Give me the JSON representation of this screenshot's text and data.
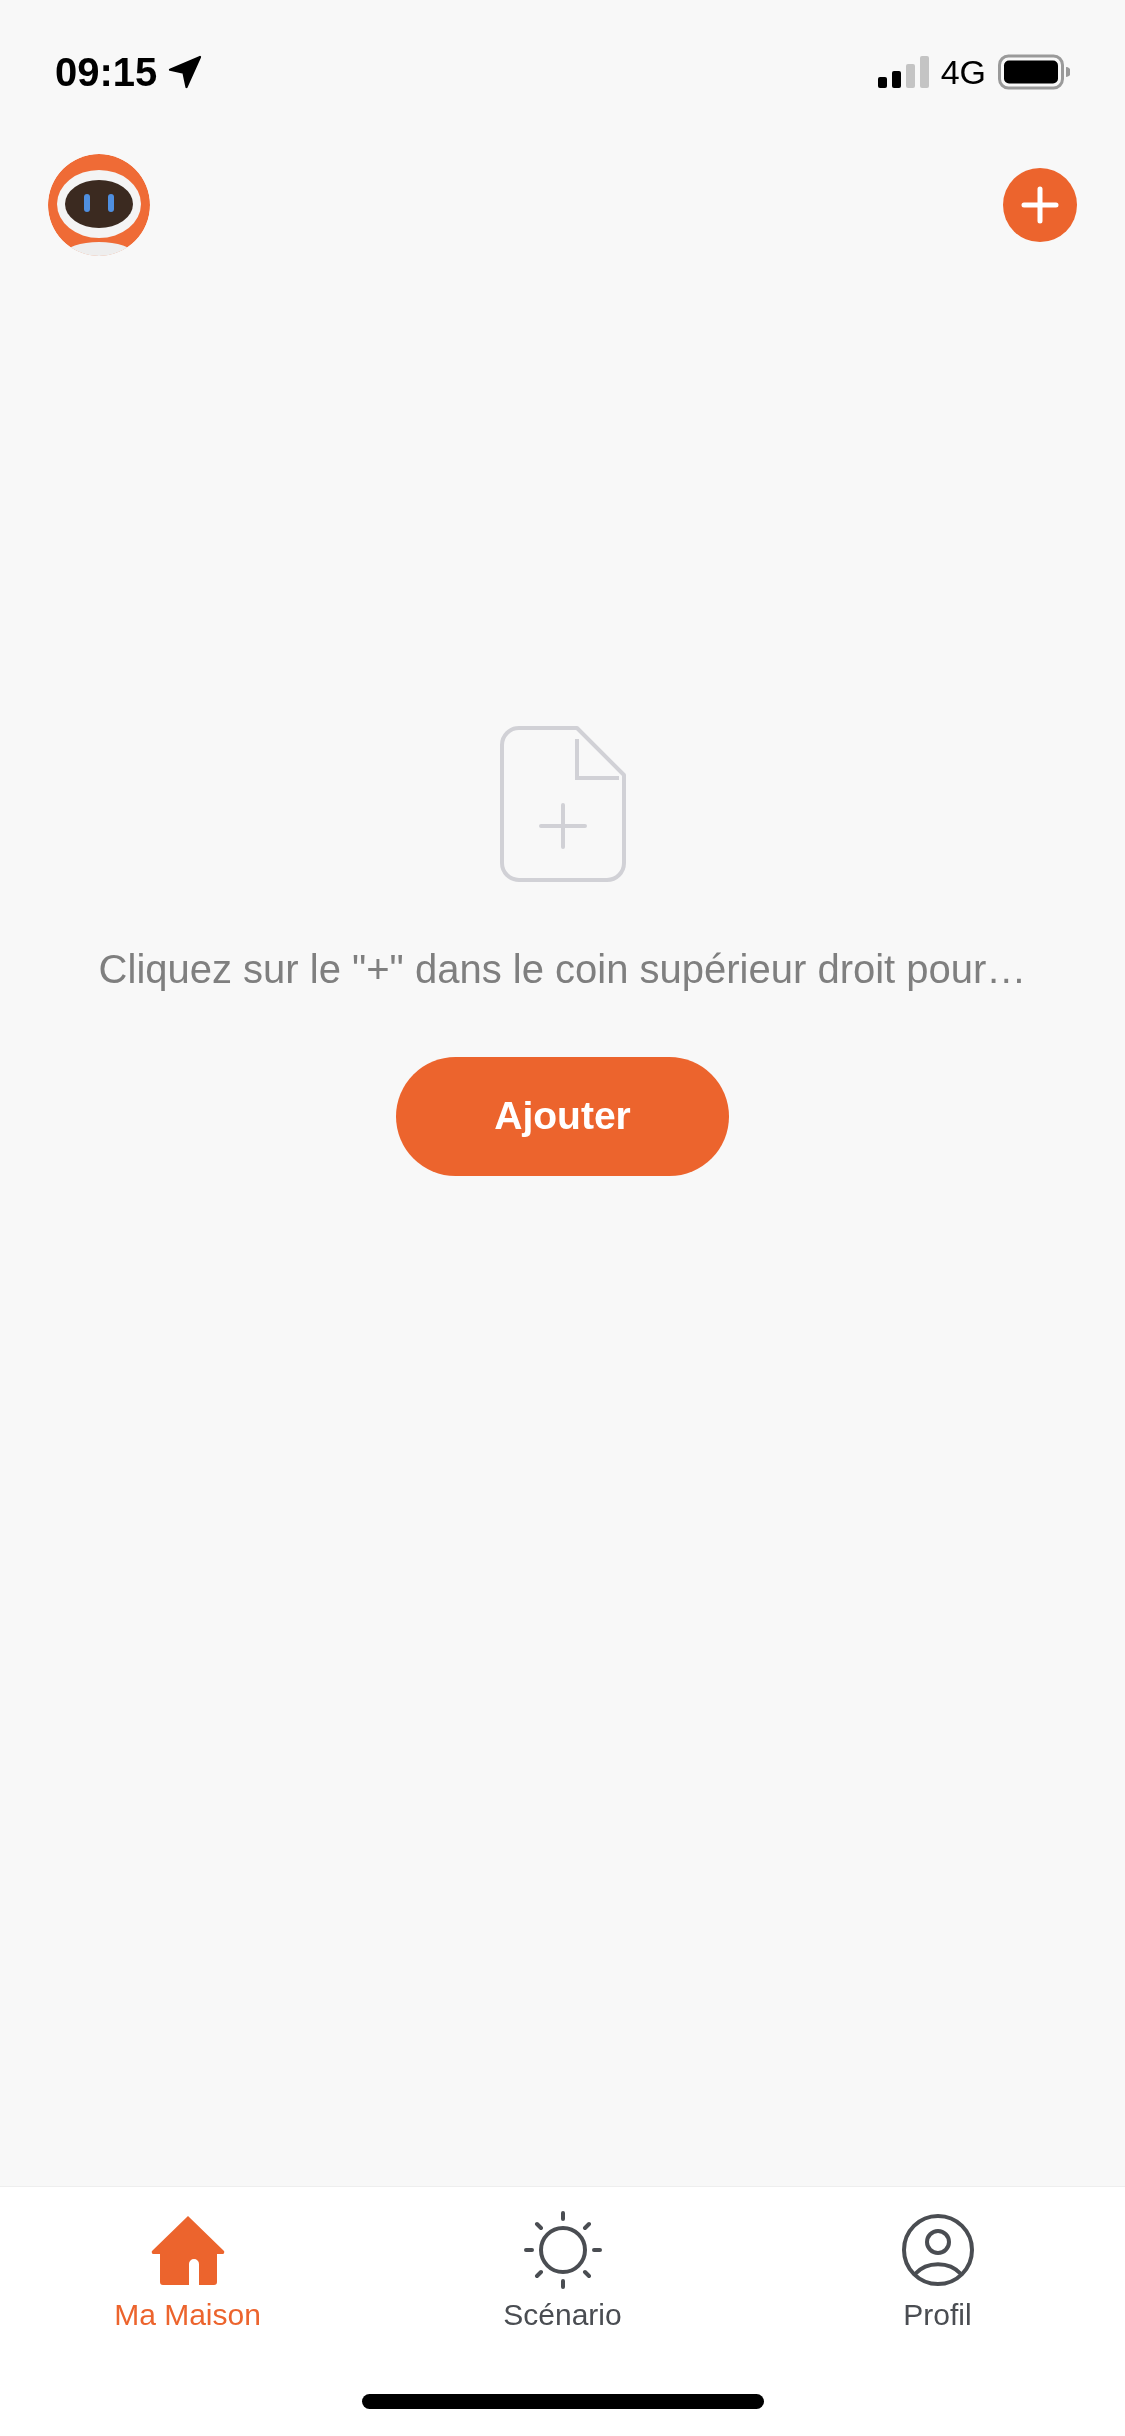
{
  "status_bar": {
    "time": "09:15",
    "network": "4G"
  },
  "empty_state": {
    "message": "Cliquez sur le \"+\" dans le coin supérieur droit pour…",
    "button": "Ajouter"
  },
  "tabs": [
    {
      "label": "Ma Maison",
      "selected": true
    },
    {
      "label": "Scénario",
      "selected": false
    },
    {
      "label": "Profil",
      "selected": false
    }
  ]
}
